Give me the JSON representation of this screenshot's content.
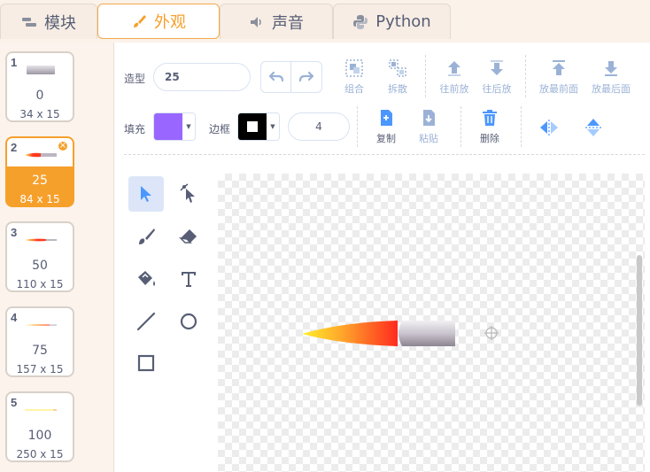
{
  "tabs": [
    {
      "label": "模块",
      "icon": "blocks-icon"
    },
    {
      "label": "外观",
      "icon": "brush-icon",
      "active": true
    },
    {
      "label": "声音",
      "icon": "speaker-icon"
    },
    {
      "label": "Python",
      "icon": "python-icon"
    }
  ],
  "costumes": [
    {
      "index": "1",
      "name": "0",
      "size": "34 x 15"
    },
    {
      "index": "2",
      "name": "25",
      "size": "84 x 15",
      "selected": true
    },
    {
      "index": "3",
      "name": "50",
      "size": "110 x 15"
    },
    {
      "index": "4",
      "name": "75",
      "size": "157 x 15"
    },
    {
      "index": "5",
      "name": "100",
      "size": "250 x 15"
    }
  ],
  "toolbar": {
    "costume_label": "造型",
    "costume_name": "25",
    "group_label": "组合",
    "ungroup_label": "拆散",
    "forward_label": "往前放",
    "backward_label": "往后放",
    "front_label": "放最前面",
    "back_label": "放最后面",
    "fill_label": "填充",
    "fill_color": "#9966ff",
    "outline_label": "边框",
    "outline_color": "#000000",
    "outline_width": "4",
    "copy_label": "复制",
    "paste_label": "粘贴",
    "delete_label": "删除"
  },
  "colors": {
    "accent": "#f6a02c",
    "blue": "#4c97ff",
    "disabled": "#9bb2d6"
  }
}
